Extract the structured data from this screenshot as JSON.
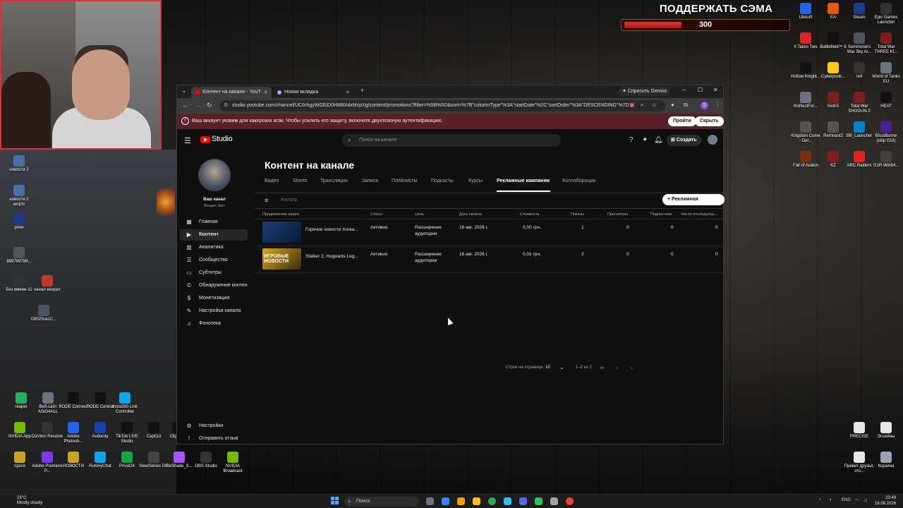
{
  "overlay": {
    "support_title": "ПОДДЕРЖАТЬ СЭМА",
    "support_value": "300",
    "support_progress": 0.35
  },
  "desktop_left": [
    {
      "label": "новости 2"
    },
    {
      "label": "новости 2 шортс"
    },
    {
      "label": "prew"
    },
    {
      "label": "898789789..."
    },
    {
      "label": "Без имени-11"
    },
    {
      "label": "канал визуал"
    },
    {
      "label": "OBSSnazC..."
    },
    {
      "label": "reaper"
    },
    {
      "label": "Веб-сайт ASIO4ALL"
    },
    {
      "label": "RODE Connect"
    },
    {
      "label": "RODE Central"
    },
    {
      "label": "Insta360 Link Controller"
    },
    {
      "label": "NVIDIA App"
    },
    {
      "label": "DaVinci Resolve"
    },
    {
      "label": "Adobe Photosh..."
    },
    {
      "label": "Audacity"
    },
    {
      "label": "TikTok LIVE Studio"
    },
    {
      "label": "CapCut"
    },
    {
      "label": "ClipCh..."
    },
    {
      "label": "проги"
    },
    {
      "label": "Adobe Premiere P..."
    },
    {
      "label": "НОВОСТИ"
    },
    {
      "label": "RutonyChat"
    },
    {
      "label": "Privat24"
    },
    {
      "label": "SteelSeries GG"
    },
    {
      "label": "ReShade_S..."
    },
    {
      "label": "OBS Studio"
    },
    {
      "label": "NVIDIA Broadcast"
    }
  ],
  "desktop_right": [
    {
      "label": "Ubisoft"
    },
    {
      "label": "EA"
    },
    {
      "label": "Steam"
    },
    {
      "label": "Epic Games Launcher"
    },
    {
      "label": "It Takes Two"
    },
    {
      "label": "Battlefield™ 6"
    },
    {
      "label": "Summoners War Sky Ar..."
    },
    {
      "label": "Total War THREE KI..."
    },
    {
      "label": "Hollow Knight..."
    },
    {
      "label": "Cyberpunk..."
    },
    {
      "label": "re9"
    },
    {
      "label": "World of Tanks EU"
    },
    {
      "label": "NoRestFor..."
    },
    {
      "label": "Nioh3"
    },
    {
      "label": "Total War SHOGUN 2"
    },
    {
      "label": "HEAT"
    },
    {
      "label": "Kingdom Come - Del..."
    },
    {
      "label": "Remnant2"
    },
    {
      "label": "BB_Launcher"
    },
    {
      "label": "Bloodborne (skip GUI)"
    },
    {
      "label": "Fall of Avalon"
    },
    {
      "label": "KZ"
    },
    {
      "label": "ARC Raiders"
    },
    {
      "label": "G1R-Win64..."
    },
    {
      "label": "PRECISE"
    },
    {
      "label": "Эссейны"
    },
    {
      "label": "Привет друзья, это..."
    },
    {
      "label": "Корзина"
    }
  ],
  "browser": {
    "tabs": [
      {
        "title": "Контент на канале - YouTube S"
      },
      {
        "title": "Новая вкладка"
      }
    ],
    "new_tab": "+",
    "gemini": "Спросить Gemini",
    "url": "studio.youtube.com/channel/UC6rhgyWGEiD0HM8XdxMcpXg/content/promotions?filter=%5B%5D&sort=%7B\"columnType\"%3A\"startDate\"%2C\"sortOrder\"%3A\"DESCENDING\"%7D",
    "profile_letter": "S",
    "warning": {
      "text": "Ваш аккаунт уязвим для хакерских атак. Чтобы усилить его защиту, включите двухэтапную аутентификацию.",
      "go": "Пройти",
      "hide": "Скрыть"
    }
  },
  "studio": {
    "logo": "Studio",
    "search_placeholder": "Поиск на канале",
    "create": "Создать",
    "channel_name": "Ваш канал",
    "channel_sub": "Вещает Sam",
    "nav": [
      {
        "label": "Главная",
        "icon": "dashboard-icon"
      },
      {
        "label": "Контент",
        "icon": "content-icon"
      },
      {
        "label": "Аналитика",
        "icon": "analytics-icon"
      },
      {
        "label": "Сообщество",
        "icon": "community-icon"
      },
      {
        "label": "Субтитры",
        "icon": "subtitles-icon"
      },
      {
        "label": "Обнаружение контен...",
        "icon": "copyright-icon"
      },
      {
        "label": "Монетизация",
        "icon": "monetization-icon"
      },
      {
        "label": "Настройка канала",
        "icon": "customization-icon"
      },
      {
        "label": "Фонотека",
        "icon": "audio-library-icon"
      }
    ],
    "settings": "Настройки",
    "feedback": "Отправить отзыв",
    "page_title": "Контент на канале",
    "tabs": [
      "Видео",
      "Shorts",
      "Трансляции",
      "Записи",
      "Плейлисты",
      "Подкасты",
      "Курсы",
      "Рекламные кампании",
      "Коллаборации"
    ],
    "active_tab": "Рекламные кампании",
    "filter_placeholder": "Фильтр",
    "add_campaign": "+ Рекламная кампания",
    "columns": [
      "Продвижение видео",
      "Статус",
      "Цель",
      "Дата начала",
      "Стоимость",
      "Показы",
      "Просмотры",
      "Подписчики",
      "Число последующ..."
    ],
    "rows": [
      {
        "title": "Горячие новости Хогва...",
        "status": "Активно",
        "goal1": "Расширение",
        "goal2": "аудитории",
        "date": "16 авг. 2026 г.",
        "cost": "0,00 грн.",
        "impressions": "1",
        "views": "0",
        "subs": "0",
        "followups": "0"
      },
      {
        "title": "Stalker 2, Hogwarts Leg...",
        "status": "Активно",
        "goal1": "Расширение",
        "goal2": "аудитории",
        "date": "16 авг. 2026 г.",
        "cost": "0,01 грн.",
        "impressions": "2",
        "views": "0",
        "subs": "0",
        "followups": "0"
      }
    ],
    "thumb2_text": "ИГРОВЫЕ НОВОСТИ",
    "pager": {
      "rows_label": "Строк на странице:",
      "rows_value": "10",
      "range": "1–2 из 2"
    }
  },
  "taskbar": {
    "weather_temp": "23°C",
    "weather_desc": "Mostly cloudy",
    "search": "Поиск",
    "lang": "ENG",
    "time": "23:49",
    "date": "16.08.2026"
  },
  "colors": {
    "accent": "#ff0000",
    "warning_bg": "#5b1f2a",
    "webcam_border": "#d8323a"
  }
}
